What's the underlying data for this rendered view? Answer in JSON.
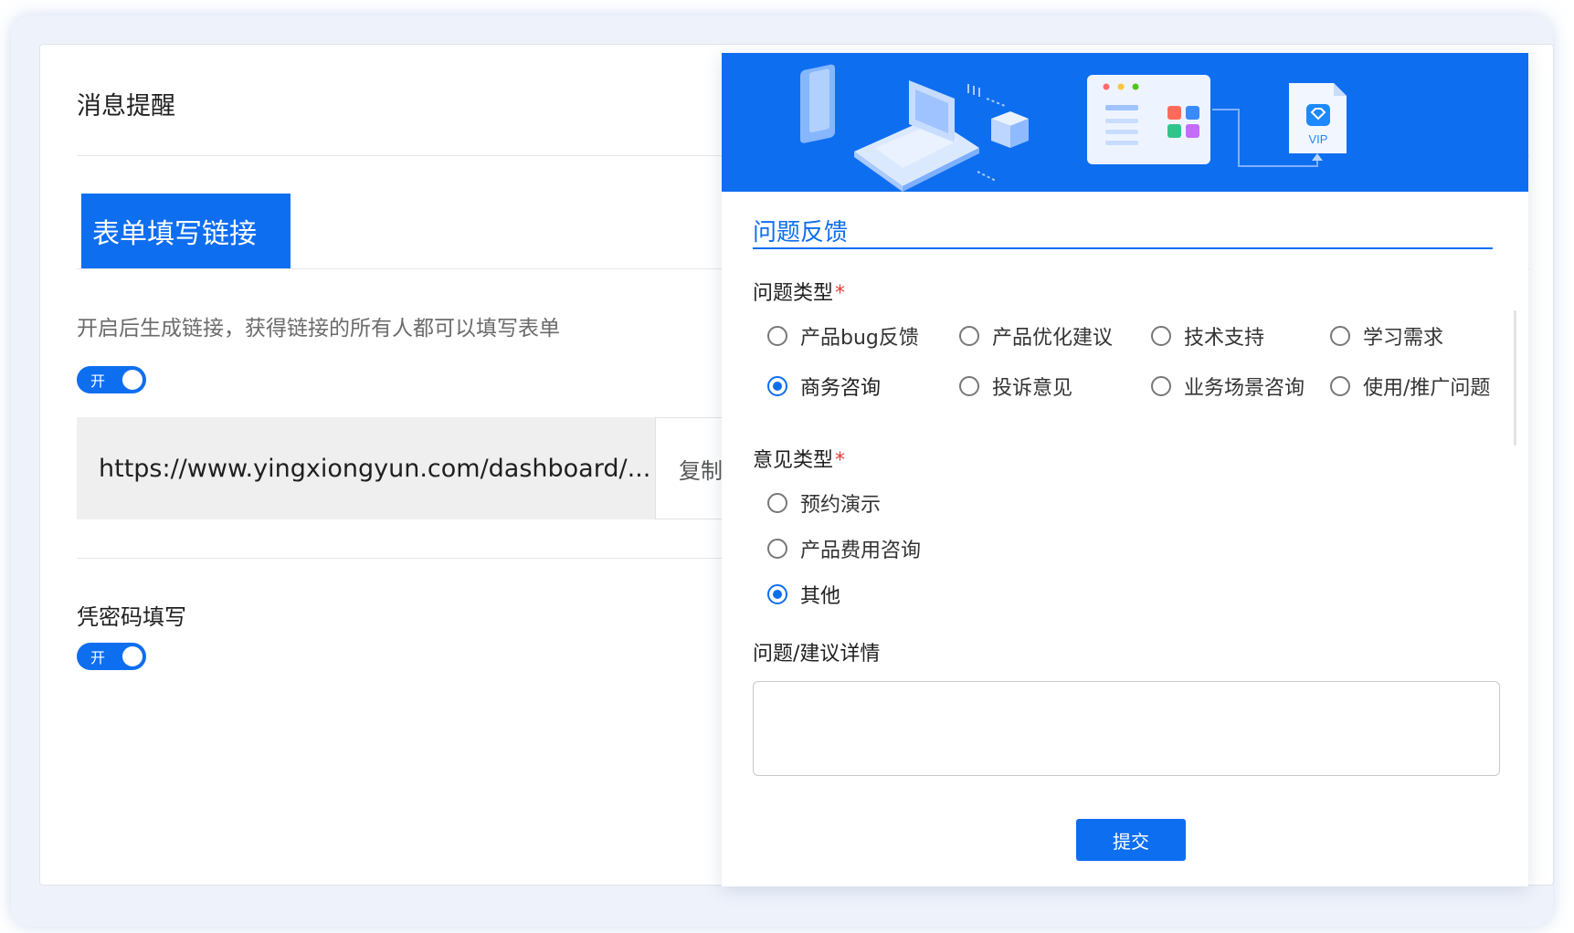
{
  "settings": {
    "title": "消息提醒",
    "tab_label": "表单填写链接",
    "description": "开启后生成链接，获得链接的所有人都可以填写表单",
    "link_toggle": "开",
    "link_url": "https://www.yingxiongyun.com/dashboard/...",
    "copy_label": "复制",
    "password_label": "凭密码填写",
    "password_toggle": "开"
  },
  "feedback": {
    "banner_vip_text": "VIP",
    "title": "问题反馈",
    "issue_type_label": "问题类型",
    "issue_type_options": [
      "产品bug反馈",
      "产品优化建议",
      "技术支持",
      "学习需求",
      "商务咨询",
      "投诉意见",
      "业务场景咨询",
      "使用/推广问题"
    ],
    "issue_type_selected": "商务咨询",
    "opinion_type_label": "意见类型",
    "opinion_type_options": [
      "预约演示",
      "产品费用咨询",
      "其他"
    ],
    "opinion_type_selected": "其他",
    "detail_label": "问题/建议详情",
    "detail_value": "",
    "required_mark": "*",
    "submit_label": "提交"
  },
  "colors": {
    "accent": "#0e6ef0",
    "required": "#e53935"
  }
}
